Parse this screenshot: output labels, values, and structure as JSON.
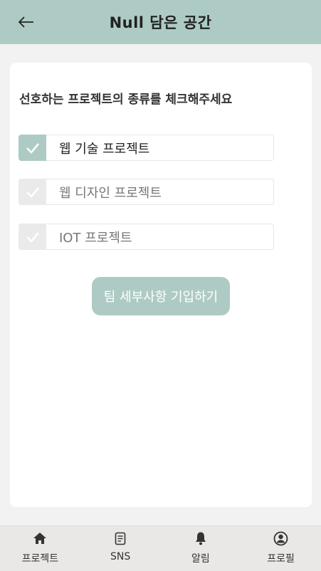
{
  "header": {
    "title": "Null 담은 공간"
  },
  "main": {
    "question": "선호하는 프로젝트의 종류를 체크해주세요",
    "options": [
      {
        "label": "웹 기술 프로젝트",
        "checked": true
      },
      {
        "label": "웹 디자인 프로젝트",
        "checked": false
      },
      {
        "label": "IOT 프로젝트",
        "checked": false
      }
    ],
    "submit_label": "팀 세부사항 기입하기"
  },
  "nav": {
    "items": [
      {
        "label": "프로젝트",
        "icon": "home-icon"
      },
      {
        "label": "SNS",
        "icon": "document-icon"
      },
      {
        "label": "알림",
        "icon": "bell-icon"
      },
      {
        "label": "프로필",
        "icon": "user-circle-icon"
      }
    ]
  },
  "colors": {
    "accent": "#adcbc4",
    "background": "#f2f2f2",
    "card": "#ffffff",
    "nav_background": "#e9e8e6"
  }
}
